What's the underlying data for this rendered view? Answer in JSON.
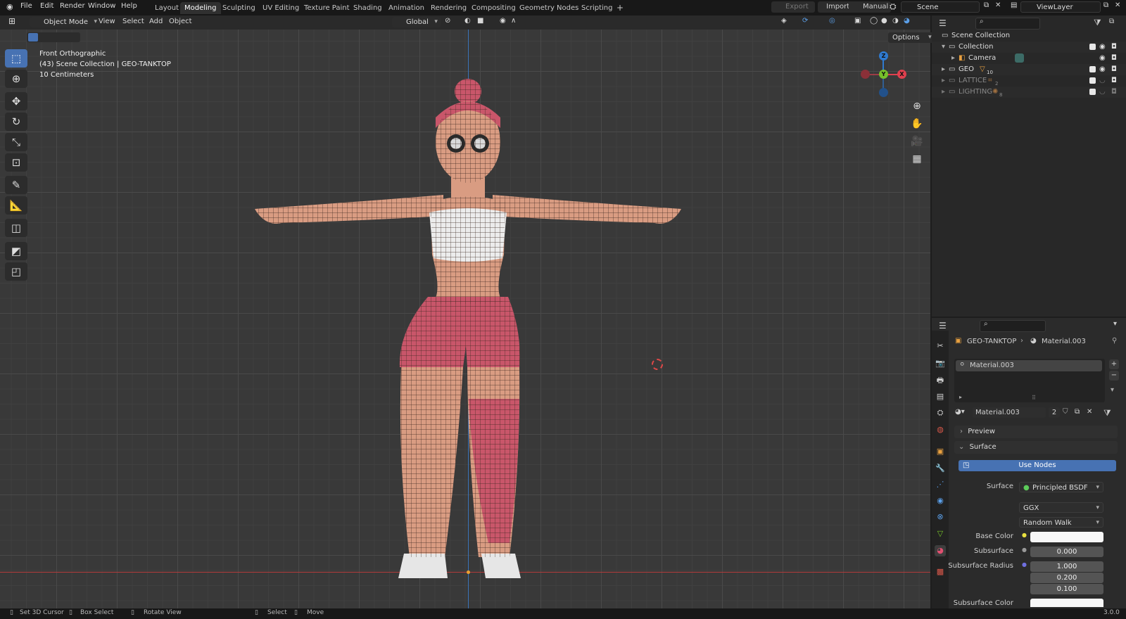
{
  "menu": [
    "File",
    "Edit",
    "Render",
    "Window",
    "Help"
  ],
  "workspaces": [
    "Layout",
    "Modeling",
    "Sculpting",
    "UV Editing",
    "Texture Paint",
    "Shading",
    "Animation",
    "Rendering",
    "Compositing",
    "Geometry Nodes",
    "Scripting"
  ],
  "active_workspace": "Modeling",
  "top_right": {
    "export": "Export",
    "import": "Import",
    "manual": "Manual",
    "scene": "Scene",
    "view_layer": "ViewLayer"
  },
  "viewport_header": {
    "mode": "Object Mode",
    "view": "View",
    "select": "Select",
    "add": "Add",
    "object": "Object",
    "transform": "Global",
    "options": "Options"
  },
  "viewport_info": {
    "view_name": "Front Orthographic",
    "collection": "(43) Scene Collection | GEO-TANKTOP",
    "scale": "10 Centimeters"
  },
  "gizmo": {
    "x": "X",
    "y": "Y",
    "z": "Z"
  },
  "outliner": {
    "root": "Scene Collection",
    "items": [
      {
        "name": "Collection",
        "indent": 1
      },
      {
        "name": "Camera",
        "indent": 2
      },
      {
        "name": "GEO",
        "indent": 1
      },
      {
        "name": "LATTICE",
        "indent": 1
      },
      {
        "name": "LIGHTING",
        "indent": 1
      }
    ],
    "badges": {
      "geo": "10",
      "lattice": "2",
      "lighting": "8"
    }
  },
  "properties": {
    "breadcrumb_object": "GEO-TANKTOP",
    "breadcrumb_material": "Material.003",
    "slot": "Material.003",
    "material_name": "Material.003",
    "users": "2",
    "preview": "Preview",
    "surface_section": "Surface",
    "use_nodes": "Use Nodes",
    "surface_label": "Surface",
    "surface_value": "Principled BSDF",
    "distribution": "GGX",
    "subsurface_method": "Random Walk",
    "base_color_label": "Base Color",
    "subsurface_label": "Subsurface",
    "subsurface_value": "0.000",
    "subsurface_radius_label": "Subsurface Radius",
    "radius": [
      "1.000",
      "0.200",
      "0.100"
    ],
    "subsurface_color_label": "Subsurface Color"
  },
  "statusbar": {
    "a": "Set 3D Cursor",
    "b": "Box Select",
    "c": "Rotate View",
    "d": "Select",
    "e": "Move",
    "version": "3.0.0"
  },
  "colors": {
    "accent": "#4772b3",
    "x_axis": "#e0404e",
    "y_axis": "#76c12a",
    "z_axis": "#2f7ad0"
  }
}
